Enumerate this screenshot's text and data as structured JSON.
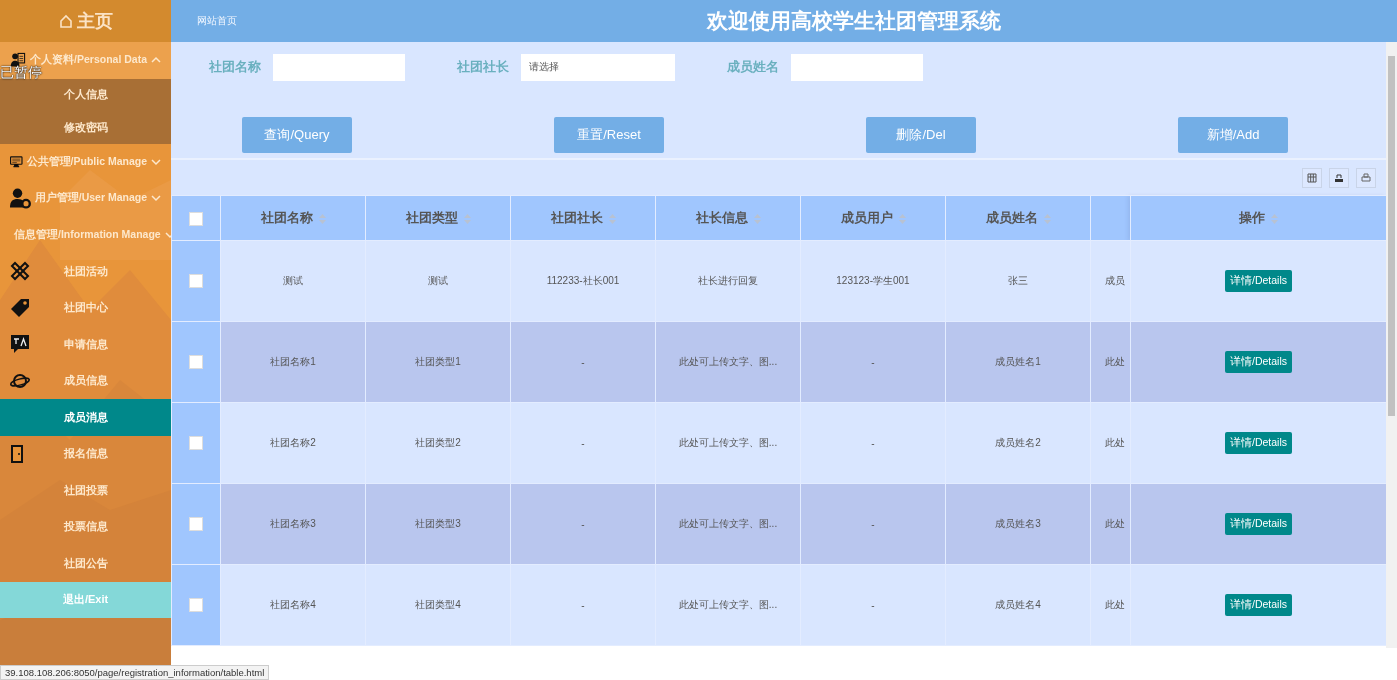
{
  "sidebar": {
    "home": "主页",
    "entries": [
      {
        "kind": "menu",
        "label": "个人资料/Personal Data",
        "expanded": true,
        "children": [
          {
            "label": "个人信息",
            "selected": false
          },
          {
            "label": "修改密码",
            "selected": false
          }
        ]
      },
      {
        "kind": "menu",
        "label": "公共管理/Public Manage",
        "expanded": false
      },
      {
        "kind": "menu",
        "label": "用户管理/User Manage",
        "expanded": false
      },
      {
        "kind": "menu",
        "label": "信息管理/Information Manage",
        "expanded": false
      },
      {
        "kind": "link",
        "label": "社团活动",
        "selected": false
      },
      {
        "kind": "link",
        "label": "社团中心",
        "selected": false
      },
      {
        "kind": "link",
        "label": "申请信息",
        "selected": false
      },
      {
        "kind": "link",
        "label": "成员信息",
        "selected": false
      },
      {
        "kind": "link",
        "label": "成员消息",
        "selected": true
      },
      {
        "kind": "link",
        "label": "报名信息",
        "selected": false
      },
      {
        "kind": "link",
        "label": "社团投票",
        "selected": false
      },
      {
        "kind": "link",
        "label": "投票信息",
        "selected": false
      },
      {
        "kind": "link",
        "label": "社团公告",
        "selected": false
      },
      {
        "kind": "exit",
        "label": "退出/Exit",
        "selected": false
      }
    ]
  },
  "header": {
    "breadcrumb": "网站首页",
    "title": "欢迎使用高校学生社团管理系统"
  },
  "search": {
    "fields": [
      {
        "kind": "text",
        "label": "社团名称"
      },
      {
        "kind": "select",
        "label": "社团社长",
        "placeholder": "请选择"
      },
      {
        "kind": "text",
        "label": "成员姓名"
      }
    ]
  },
  "buttons": [
    "查询/Query",
    "重置/Reset",
    "删除/Del",
    "新增/Add"
  ],
  "table": {
    "select_all_checked": false,
    "columns": [
      {
        "kind": "text",
        "label": "社团名称",
        "sortable": true
      },
      {
        "kind": "text",
        "label": "社团类型",
        "sortable": true
      },
      {
        "kind": "text",
        "label": "社团社长",
        "sortable": true
      },
      {
        "kind": "text",
        "label": "社长信息",
        "sortable": true
      },
      {
        "kind": "text",
        "label": "成员用户",
        "sortable": true
      },
      {
        "kind": "text",
        "label": "成员姓名",
        "sortable": true
      },
      {
        "kind": "text",
        "sortable": false
      },
      {
        "kind": "action",
        "label": "操作",
        "sortable": true
      }
    ],
    "rows": [
      {
        "checked": false,
        "cells": [
          "测试",
          "测试",
          "112233-社长001",
          "社长进行回复",
          "123123-学生001",
          "张三",
          "成员",
          "详情/Details"
        ]
      },
      {
        "checked": false,
        "cells": [
          "社团名称1",
          "社团类型1",
          "-",
          "此处可上传文字、图...",
          "-",
          "成员姓名1",
          "此处",
          "详情/Details"
        ]
      },
      {
        "checked": false,
        "cells": [
          "社团名称2",
          "社团类型2",
          "-",
          "此处可上传文字、图...",
          "-",
          "成员姓名2",
          "此处",
          "详情/Details"
        ]
      },
      {
        "checked": false,
        "cells": [
          "社团名称3",
          "社团类型3",
          "-",
          "此处可上传文字、图...",
          "-",
          "成员姓名3",
          "此处",
          "详情/Details"
        ]
      },
      {
        "checked": false,
        "cells": [
          "社团名称4",
          "社团类型4",
          "-",
          "此处可上传文字、图...",
          "-",
          "成员姓名4",
          "此处",
          "详情/Details"
        ]
      }
    ]
  },
  "overlay_label": "已暂停",
  "status_url": "39.108.108.206:8050/page/registration_information/table.html"
}
